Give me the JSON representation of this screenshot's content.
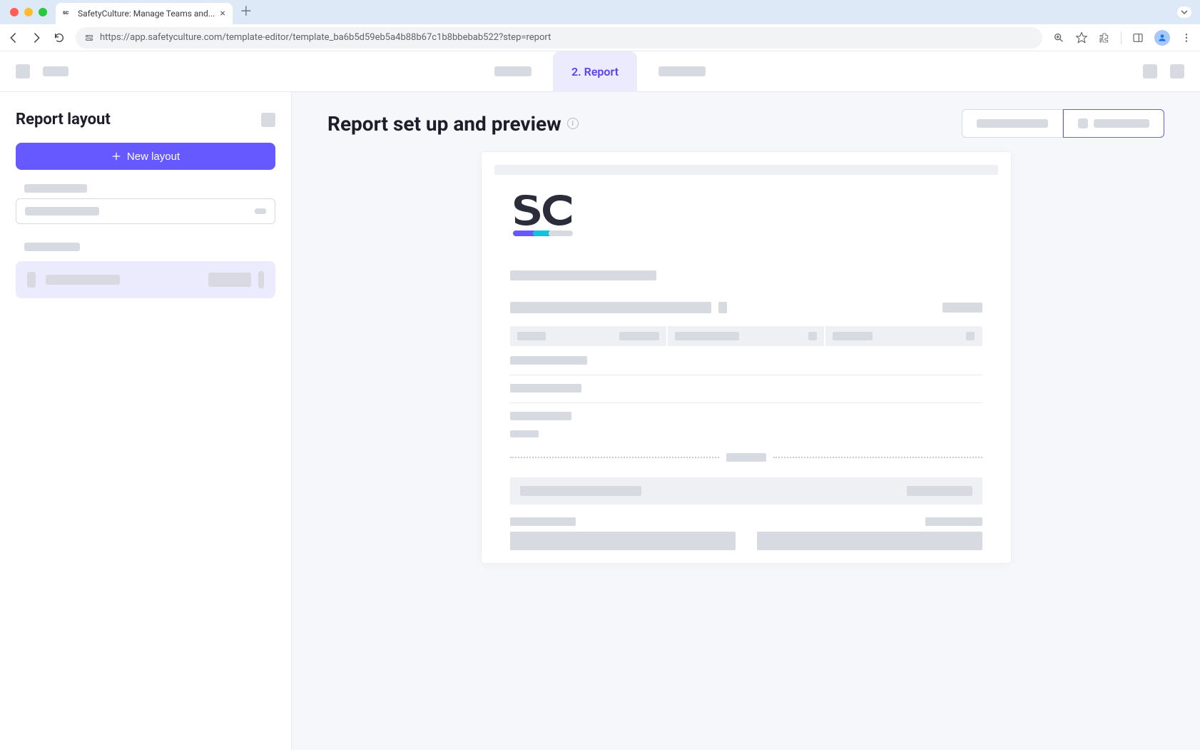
{
  "browser": {
    "tab_title": "SafetyCulture: Manage Teams and...",
    "url": "https://app.safetyculture.com/template-editor/template_ba6b5d59eb5a4b88b67c1b8bbebab522?step=report"
  },
  "header": {
    "active_tab": "2. Report"
  },
  "sidebar": {
    "title": "Report layout",
    "new_layout_label": "New layout"
  },
  "content": {
    "title": "Report set up and preview"
  }
}
